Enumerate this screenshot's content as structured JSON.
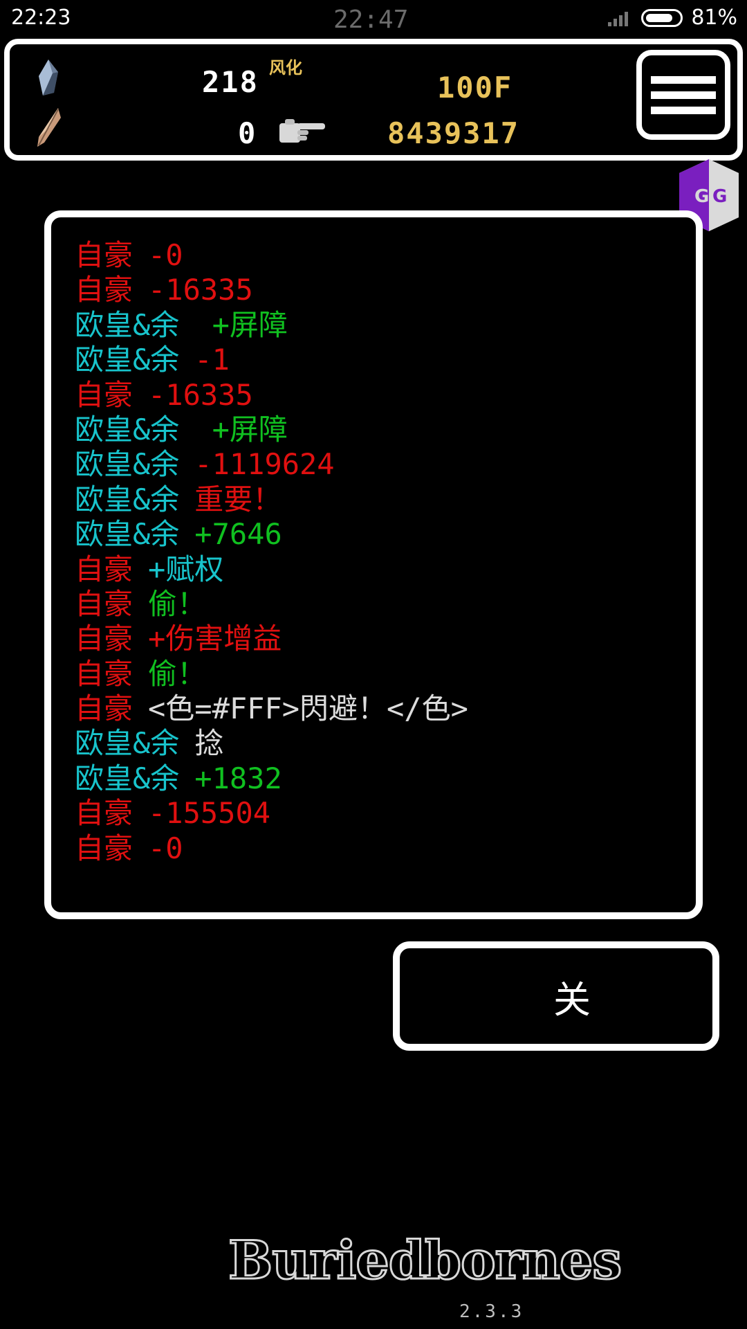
{
  "status_bar": {
    "time": "22:23",
    "center_time": "22:47",
    "battery_percent": "81%"
  },
  "hud": {
    "gem_count": "218",
    "status_tag": "风化",
    "feather_count": "0",
    "floor": "100F",
    "gold": "8439317"
  },
  "log": [
    {
      "name": "自豪",
      "name_color": "red",
      "value": "-0",
      "value_color": "red"
    },
    {
      "name": "自豪",
      "name_color": "red",
      "value": "-16335",
      "value_color": "red"
    },
    {
      "name": "欧皇&余",
      "name_color": "cyan",
      "value": " +屏障",
      "value_color": "green"
    },
    {
      "name": "欧皇&余",
      "name_color": "cyan",
      "value": "-1",
      "value_color": "red"
    },
    {
      "name": "自豪",
      "name_color": "red",
      "value": "-16335",
      "value_color": "red"
    },
    {
      "name": "欧皇&余",
      "name_color": "cyan",
      "value": " +屏障",
      "value_color": "green"
    },
    {
      "name": "欧皇&余",
      "name_color": "cyan",
      "value": "-1119624",
      "value_color": "red"
    },
    {
      "name": "欧皇&余",
      "name_color": "cyan",
      "value": "重要！",
      "value_color": "red"
    },
    {
      "name": "欧皇&余",
      "name_color": "cyan",
      "value": "+7646",
      "value_color": "green"
    },
    {
      "name": "自豪",
      "name_color": "red",
      "value": "+赋权",
      "value_color": "cyan"
    },
    {
      "name": "自豪",
      "name_color": "red",
      "value": "偷！",
      "value_color": "green"
    },
    {
      "name": "自豪",
      "name_color": "red",
      "value": "+伤害增益",
      "value_color": "red"
    },
    {
      "name": "自豪",
      "name_color": "red",
      "value": "偷！",
      "value_color": "green"
    },
    {
      "name": "自豪",
      "name_color": "red",
      "value": "<色=#FFF>閃避！</色>",
      "value_color": "white"
    },
    {
      "name": "欧皇&余",
      "name_color": "cyan",
      "value": "捻",
      "value_color": "white"
    },
    {
      "name": "欧皇&余",
      "name_color": "cyan",
      "value": "+1832",
      "value_color": "green"
    },
    {
      "name": "自豪",
      "name_color": "red",
      "value": "-155504",
      "value_color": "red"
    },
    {
      "name": "自豪",
      "name_color": "red",
      "value": "-0",
      "value_color": "red"
    }
  ],
  "close_button": {
    "label": "关"
  },
  "logo": {
    "text": "Buriedbornes",
    "version": "2.3.3"
  },
  "colors": {
    "red": "#e01010",
    "cyan": "#18c4cc",
    "green": "#10c020",
    "gold": "#e8c25a",
    "white": "#dcdcdc"
  },
  "icons": {
    "gem": "crystal-gem-icon",
    "feather": "quill-feather-icon",
    "hand": "pointing-hand-icon",
    "menu": "hamburger-menu-icon",
    "gg": "gameguardian-icon"
  }
}
